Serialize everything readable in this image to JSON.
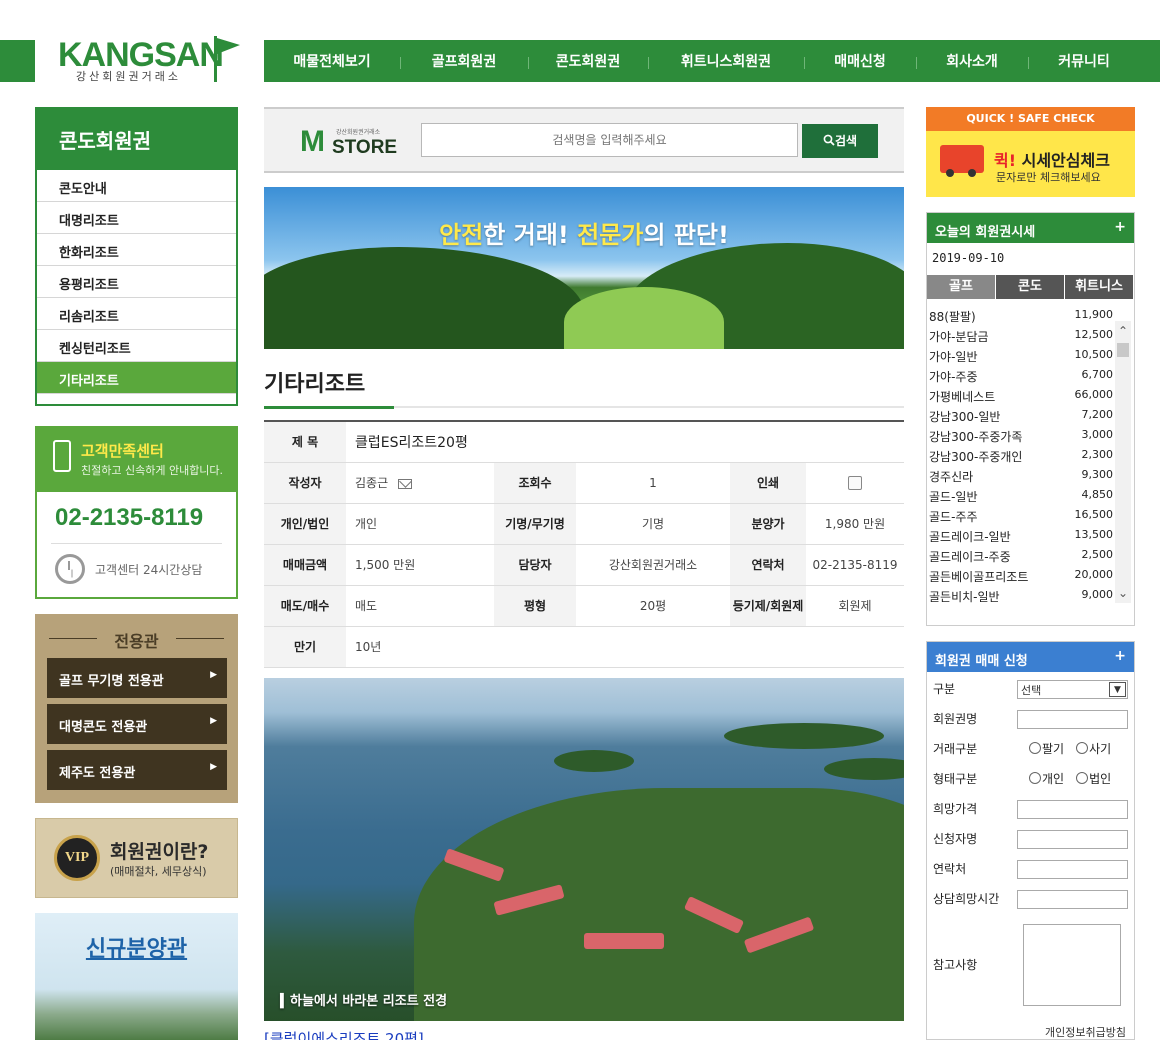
{
  "header": {
    "logo_text": "KANGSAN",
    "logo_sub": "강산회원권거래소",
    "nav": [
      "매물전체보기",
      "골프회원권",
      "콘도회원권",
      "휘트니스회원권",
      "매매신청",
      "회사소개",
      "커뮤니티"
    ]
  },
  "sidebar": {
    "title": "콘도회원권",
    "items": [
      "콘도안내",
      "대명리조트",
      "한화리조트",
      "용평리조트",
      "리솜리조트",
      "켄싱턴리조트",
      "기타리조트"
    ]
  },
  "customer_center": {
    "title": "고객만족센터",
    "subtitle": "친절하고 신속하게 안내합니다.",
    "phone": "02-2135-8119",
    "hours": "고객센터 24시간상담"
  },
  "exclusive": {
    "title": "전용관",
    "buttons": [
      "골프 무기명 전용관",
      "대명콘도 전용관",
      "제주도 전용관"
    ]
  },
  "vip": {
    "badge": "VIP",
    "title": "회원권이란?",
    "subtitle": "(매매절차, 세무상식)"
  },
  "new_sale": {
    "title": "신규분양관"
  },
  "search": {
    "brand_m": "M",
    "brand_store": "STORE",
    "brand_tiny": "강산회원권거래소",
    "placeholder": "검색명을 입력해주세요",
    "button": "검색"
  },
  "banner": {
    "slogan_a": "안전",
    "slogan_b": "한 거래! ",
    "slogan_c": "전문가",
    "slogan_d": "의 판단!"
  },
  "page_title": "기타리조트",
  "info": {
    "title_label": "제 목",
    "title_value": "클럽ES리조트20평",
    "author_label": "작성자",
    "author_value": "김종근",
    "views_label": "조회수",
    "views_value": "1",
    "print_label": "인쇄",
    "type_label": "개인/법인",
    "type_value": "개인",
    "named_label": "기명/무기명",
    "named_value": "기명",
    "price_label": "분양가",
    "price_value": "1,980 만원",
    "sale_label": "매매금액",
    "sale_value": "1,500 만원",
    "manager_label": "담당자",
    "manager_value": "강산회원권거래소",
    "contact_label": "연락처",
    "contact_value": "02-2135-8119",
    "trade_label": "매도/매수",
    "trade_value": "매도",
    "size_label": "평형",
    "size_value": "20평",
    "reg_label": "등기제/회원제",
    "reg_value": "회원제",
    "expire_label": "만기",
    "expire_value": "10년"
  },
  "photo_caption": "하늘에서 바라본 리조트 전경",
  "under_link": "[클럽이에스리조트 20평]",
  "quick": {
    "bar": "QUICK ! SAFE CHECK",
    "t1a": "퀵!",
    "t1b": " 시세안심체크",
    "t2": "문자로만 체크해보세요"
  },
  "today": {
    "title": "오늘의 회원권시세",
    "plus": "+",
    "date": "2019-09-10",
    "tabs": [
      "골프",
      "콘도",
      "휘트니스"
    ],
    "rows": [
      {
        "name": "88(팔팔)",
        "price": "11,900"
      },
      {
        "name": "가야-분담금",
        "price": "12,500"
      },
      {
        "name": "가야-일반",
        "price": "10,500"
      },
      {
        "name": "가야-주중",
        "price": "6,700"
      },
      {
        "name": "가평베네스트",
        "price": "66,000"
      },
      {
        "name": "강남300-일반",
        "price": "7,200"
      },
      {
        "name": "강남300-주중가족",
        "price": "3,000"
      },
      {
        "name": "강남300-주중개인",
        "price": "2,300"
      },
      {
        "name": "경주신라",
        "price": "9,300"
      },
      {
        "name": "골드-일반",
        "price": "4,850"
      },
      {
        "name": "골드-주주",
        "price": "16,500"
      },
      {
        "name": "골드레이크-일반",
        "price": "13,500"
      },
      {
        "name": "골드레이크-주중",
        "price": "2,500"
      },
      {
        "name": "골든베이골프리조트",
        "price": "20,000"
      },
      {
        "name": "골든비치-일반",
        "price": "9,000"
      }
    ]
  },
  "apply": {
    "title": "회원권 매매 신청",
    "plus": "+",
    "labels": [
      "구분",
      "회원권명",
      "거래구분",
      "형태구분",
      "희망가격",
      "신청자명",
      "연락처",
      "상담희망시간",
      "참고사항"
    ],
    "select_value": "선택",
    "trade_opts": [
      "팔기",
      "사기"
    ],
    "form_opts": [
      "개인",
      "법인"
    ],
    "privacy": "개인정보취급방침"
  }
}
